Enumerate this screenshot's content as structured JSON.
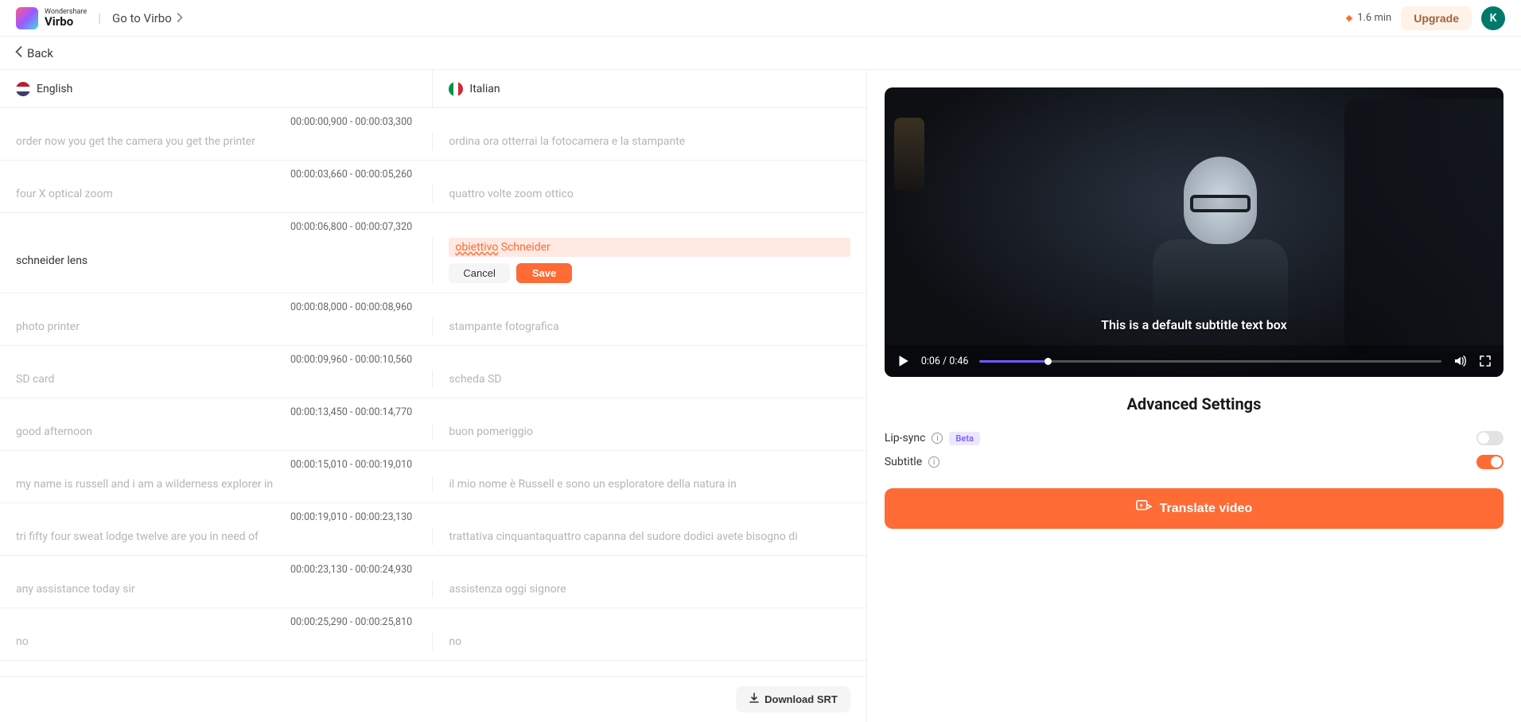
{
  "header": {
    "brand_top": "Wondershare",
    "brand_name": "Virbo",
    "goto_label": "Go to Virbo",
    "minutes": "1.6 min",
    "upgrade": "Upgrade",
    "avatar_initial": "K"
  },
  "back_label": "Back",
  "lang": {
    "source": "English",
    "target": "Italian"
  },
  "subs": [
    {
      "time": "00:00:00,900 - 00:00:03,300",
      "src": "order now you get the camera you get the printer",
      "tgt": "ordina ora otterrai la fotocamera e la stampante",
      "editing": false
    },
    {
      "time": "00:00:03,660 - 00:00:05,260",
      "src": "four X optical zoom",
      "tgt": "quattro volte zoom ottico",
      "editing": false
    },
    {
      "time": "00:00:06,800 - 00:00:07,320",
      "src": "schneider lens",
      "tgt": "obiettivo Schneider",
      "editing": true
    },
    {
      "time": "00:00:08,000 - 00:00:08,960",
      "src": "photo printer",
      "tgt": "stampante fotografica",
      "editing": false
    },
    {
      "time": "00:00:09,960 - 00:00:10,560",
      "src": "SD card",
      "tgt": "scheda SD",
      "editing": false
    },
    {
      "time": "00:00:13,450 - 00:00:14,770",
      "src": "good afternoon",
      "tgt": "buon pomeriggio",
      "editing": false
    },
    {
      "time": "00:00:15,010 - 00:00:19,010",
      "src": "my name is russell and i am a wilderness explorer in",
      "tgt": "il mio nome è Russell e sono un esploratore della natura in",
      "editing": false
    },
    {
      "time": "00:00:19,010 - 00:00:23,130",
      "src": "tri fifty four sweat lodge twelve are you in need of",
      "tgt": "trattativa cinquantaquattro capanna del sudore dodici avete bisogno di",
      "editing": false
    },
    {
      "time": "00:00:23,130 - 00:00:24,930",
      "src": "any assistance today sir",
      "tgt": "assistenza oggi signore",
      "editing": false
    },
    {
      "time": "00:00:25,290 - 00:00:25,810",
      "src": "no",
      "tgt": "no",
      "editing": false
    }
  ],
  "edit_actions": {
    "cancel": "Cancel",
    "save": "Save"
  },
  "download_srt": "Download SRT",
  "player": {
    "subtitle": "This is a default subtitle text box",
    "time": "0:06 / 0:46"
  },
  "advanced": {
    "title": "Advanced Settings",
    "lipsync": "Lip-sync",
    "beta": "Beta",
    "subtitle": "Subtitle"
  },
  "translate_btn": "Translate video"
}
